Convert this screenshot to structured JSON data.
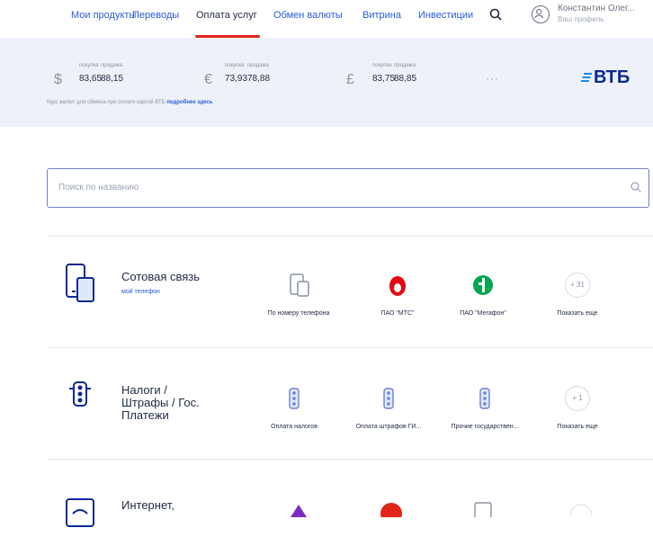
{
  "nav": {
    "items": [
      "Мои продукты",
      "Переводы",
      "Оплата услуг",
      "Обмен валюты",
      "Витрина",
      "Инвестиции"
    ],
    "active_index": 2,
    "user_name": "Константин Олег...",
    "user_sub": "Ваш профиль"
  },
  "rates": {
    "currencies": [
      {
        "symbol": "$",
        "buy_label": "покупка",
        "sell_label": "продажа",
        "buy": "83,65",
        "sell": "88,15"
      },
      {
        "symbol": "€",
        "buy_label": "покупка",
        "sell_label": "продажа",
        "buy": "73,93",
        "sell": "78,88"
      },
      {
        "symbol": "£",
        "buy_label": "покупка",
        "sell_label": "продажа",
        "buy": "83,75",
        "sell": "88,85"
      }
    ],
    "more": "···",
    "brand": "ВТБ",
    "note": "Курс валют для обмена при оплате картой ВТБ",
    "note_link": "подробнее здесь"
  },
  "search": {
    "placeholder": "Поиск по названию"
  },
  "categories": [
    {
      "title": "Сотовая связь",
      "subtitle": "мой телефон",
      "icon": "phone-icon",
      "tiles": [
        {
          "label": "По номеру телефона",
          "icon": "phone-number-icon"
        },
        {
          "label": "ПАО \"МТС\"",
          "icon": "mts-icon",
          "color": "#e30611"
        },
        {
          "label": "ПАО \"Мегафон\"",
          "icon": "megafon-icon",
          "color": "#00a650"
        },
        {
          "label": "Показать еще",
          "more": "+ 31"
        }
      ]
    },
    {
      "title": "Налоги / Штрафы / Гос. Платежи",
      "title_lines": [
        "Налоги /",
        "Штрафы / Гос.",
        "Платежи"
      ],
      "icon": "traffic-light-icon",
      "tiles": [
        {
          "label": "Оплата налогов",
          "icon": "traffic-light-icon"
        },
        {
          "label": "Оплата штрафов ГИ...",
          "icon": "traffic-light-icon"
        },
        {
          "label": "Прочие государствен...",
          "icon": "traffic-light-icon"
        },
        {
          "label": "Показать еще",
          "more": "+ 1"
        }
      ]
    },
    {
      "title": "Интернет,",
      "icon": "wifi-icon",
      "tiles": [
        {
          "icon": "provider-icon",
          "color": "#7b2cbf"
        },
        {
          "icon": "provider-icon",
          "color": "#e1251b"
        },
        {
          "icon": "phone-number-icon"
        },
        {
          "icon": "more-icon"
        }
      ]
    }
  ]
}
